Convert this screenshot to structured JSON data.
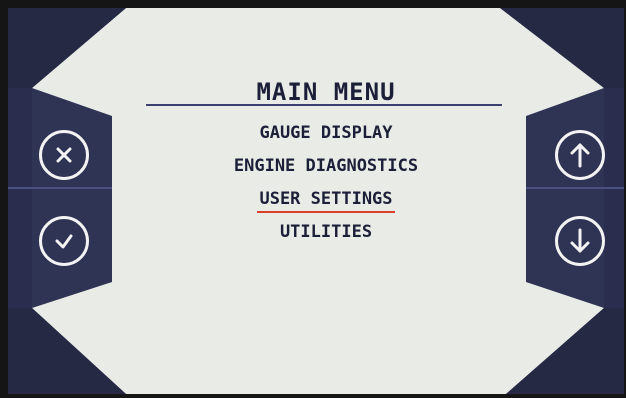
{
  "menu": {
    "title": "MAIN MENU",
    "items": [
      {
        "label": "GAUGE DISPLAY",
        "selected": false
      },
      {
        "label": "ENGINE DIAGNOSTICS",
        "selected": false
      },
      {
        "label": "USER SETTINGS",
        "selected": true
      },
      {
        "label": "UTILITIES",
        "selected": false
      }
    ]
  },
  "buttons": {
    "left": [
      {
        "name": "close-button",
        "icon": "close-icon"
      },
      {
        "name": "confirm-button",
        "icon": "check-icon"
      }
    ],
    "right": [
      {
        "name": "scroll-up-button",
        "icon": "arrow-up-icon"
      },
      {
        "name": "scroll-down-button",
        "icon": "arrow-down-icon"
      }
    ]
  },
  "colors": {
    "screen_background": "#e9ece6",
    "side_panel": "#2a2d4e",
    "text": "#1c1f38",
    "selection_underline": "#d8402c",
    "button_ring": "#f3f3f3"
  }
}
